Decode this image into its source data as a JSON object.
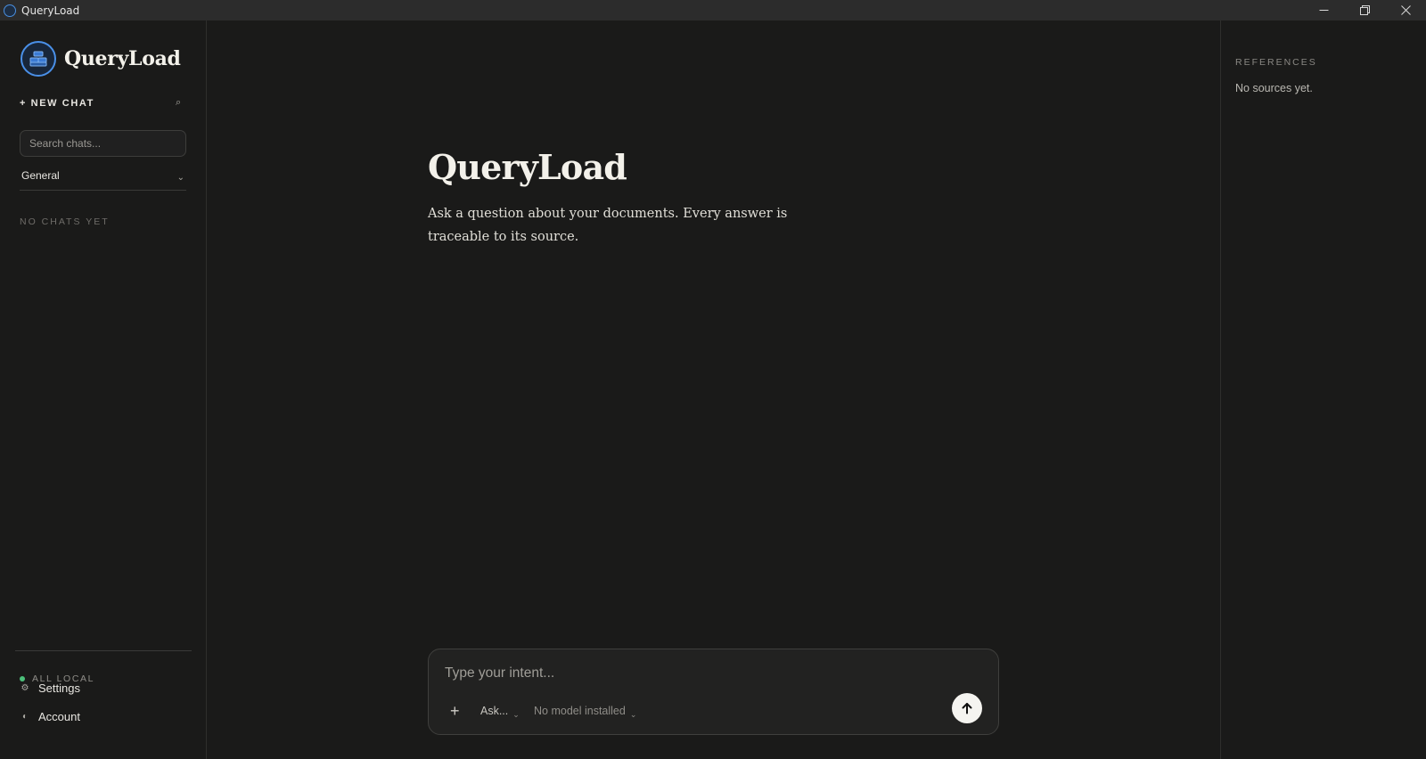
{
  "window": {
    "title": "QueryLoad",
    "minimize_glyph": "—",
    "maximize_glyph": "❐",
    "close_glyph": "✕"
  },
  "sidebar": {
    "brand_name": "QueryLoad",
    "new_chat_label": "+ NEW CHAT",
    "search_icon_glyph": "⌕",
    "search_placeholder": "Search chats...",
    "project_selected": "General",
    "project_chevron": "⌄",
    "empty_state": "NO CHATS YET",
    "status_label": "ALL LOCAL",
    "settings_icon": "⚙",
    "settings_label": "Settings",
    "account_icon": "◐",
    "account_label": "Account"
  },
  "main": {
    "title": "QueryLoad",
    "subtitle": "Ask a question about your documents. Every answer is traceable to its source.",
    "composer": {
      "placeholder": "Type your intent...",
      "attach_glyph": "+",
      "mode_label": "Ask...",
      "model_label": "No model installed",
      "chevron": "⌄"
    }
  },
  "references": {
    "title": "REFERENCES",
    "empty_state": "No sources yet."
  },
  "colors": {
    "background": "#1a1a19",
    "accent_blue": "#4a90e8",
    "status_green": "#4cc07a",
    "send_button": "#f5f4f0"
  },
  "icons": [
    "app-logo-icon",
    "search-icon",
    "chevron-down-icon",
    "gear-icon",
    "account-icon",
    "plus-icon",
    "arrow-up-icon",
    "minimize-icon",
    "maximize-icon",
    "close-icon"
  ]
}
